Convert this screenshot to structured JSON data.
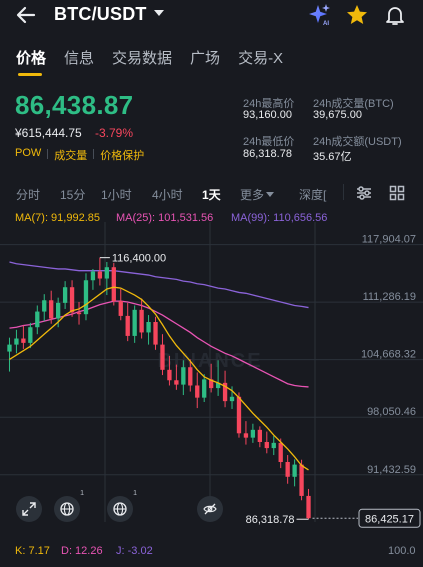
{
  "header": {
    "pair": "BTC/USDT",
    "icons": [
      "back-arrow-icon",
      "caret-down-icon",
      "ai-sparkle-icon",
      "star-icon",
      "bell-icon"
    ],
    "ai_label": "AI"
  },
  "tabs": [
    {
      "label": "价格",
      "active": true
    },
    {
      "label": "信息",
      "active": false
    },
    {
      "label": "交易数据",
      "active": false
    },
    {
      "label": "广场",
      "active": false
    },
    {
      "label": "交易-X",
      "active": false
    }
  ],
  "ticker": {
    "last_price": "86,438.87",
    "fiat_price": "¥615,444.75",
    "change_pct": "-3.79%",
    "badges": [
      "POW",
      "成交量",
      "价格保护"
    ],
    "high_label": "24h最高价",
    "high_value": "93,160.00",
    "low_label": "24h最低价",
    "low_value": "86,318.78",
    "vol_btc_label": "24h成交量(BTC)",
    "vol_btc_value": "39,675.00",
    "vol_usdt_label": "24h成交额(USDT)",
    "vol_usdt_value": "35.67亿"
  },
  "timeframes": {
    "items": [
      "分时",
      "15分",
      "1小时",
      "4小时",
      "1天",
      "更多",
      "深度["
    ],
    "active": "1天"
  },
  "ma": {
    "ma7": "MA(7): 91,992.85",
    "ma25": "MA(25): 101,531.56",
    "ma99": "MA(99): 110,656.56"
  },
  "chart_data": {
    "type": "candlestick",
    "title": "",
    "y_ticks": [
      "117,904.07",
      "111,286.19",
      "104,668.32",
      "98,050.46",
      "91,432.59"
    ],
    "ylim": [
      86000,
      120500
    ],
    "high_marker": "116,400.00",
    "low_marker": "86,318.78",
    "current_price": "86,425.17",
    "watermark": "BINANCE",
    "colors": {
      "up": "#2ebd85",
      "down": "#f6465d",
      "ma7": "#f0b90b",
      "ma25": "#e854b4",
      "ma99": "#8b63d9"
    },
    "candles": [
      {
        "o": 105600,
        "h": 107200,
        "l": 103300,
        "c": 106400
      },
      {
        "o": 106400,
        "h": 108100,
        "l": 105400,
        "c": 107100
      },
      {
        "o": 107100,
        "h": 108600,
        "l": 105900,
        "c": 106600
      },
      {
        "o": 106600,
        "h": 108900,
        "l": 106000,
        "c": 108400
      },
      {
        "o": 108400,
        "h": 110900,
        "l": 107600,
        "c": 110200
      },
      {
        "o": 110200,
        "h": 112200,
        "l": 109100,
        "c": 111500
      },
      {
        "o": 111500,
        "h": 112600,
        "l": 108800,
        "c": 109400
      },
      {
        "o": 109400,
        "h": 111800,
        "l": 108400,
        "c": 111200
      },
      {
        "o": 111200,
        "h": 113700,
        "l": 110500,
        "c": 113000
      },
      {
        "o": 113000,
        "h": 113800,
        "l": 109600,
        "c": 110100
      },
      {
        "o": 110100,
        "h": 111300,
        "l": 108700,
        "c": 109900
      },
      {
        "o": 109900,
        "h": 114600,
        "l": 109200,
        "c": 113800
      },
      {
        "o": 113800,
        "h": 115100,
        "l": 112700,
        "c": 114800
      },
      {
        "o": 114800,
        "h": 116400,
        "l": 113200,
        "c": 114000
      },
      {
        "o": 114000,
        "h": 115900,
        "l": 112100,
        "c": 115300
      },
      {
        "o": 115300,
        "h": 115800,
        "l": 110900,
        "c": 111400
      },
      {
        "o": 111400,
        "h": 112800,
        "l": 109200,
        "c": 109700
      },
      {
        "o": 109700,
        "h": 111200,
        "l": 106800,
        "c": 107400
      },
      {
        "o": 107400,
        "h": 110900,
        "l": 106600,
        "c": 110400
      },
      {
        "o": 110400,
        "h": 111700,
        "l": 107100,
        "c": 107800
      },
      {
        "o": 107800,
        "h": 109800,
        "l": 106400,
        "c": 109000
      },
      {
        "o": 109000,
        "h": 109600,
        "l": 105800,
        "c": 106400
      },
      {
        "o": 106400,
        "h": 107600,
        "l": 102900,
        "c": 103500
      },
      {
        "o": 103500,
        "h": 105100,
        "l": 101700,
        "c": 102300
      },
      {
        "o": 102300,
        "h": 104100,
        "l": 101200,
        "c": 101800
      },
      {
        "o": 101800,
        "h": 104600,
        "l": 100600,
        "c": 103800
      },
      {
        "o": 103800,
        "h": 104700,
        "l": 101000,
        "c": 101700
      },
      {
        "o": 101700,
        "h": 103200,
        "l": 99100,
        "c": 100300
      },
      {
        "o": 100300,
        "h": 103000,
        "l": 99800,
        "c": 102400
      },
      {
        "o": 102400,
        "h": 104200,
        "l": 100900,
        "c": 101400
      },
      {
        "o": 101400,
        "h": 104600,
        "l": 100500,
        "c": 102000
      },
      {
        "o": 102000,
        "h": 103400,
        "l": 99200,
        "c": 99900
      },
      {
        "o": 99900,
        "h": 101600,
        "l": 99000,
        "c": 100400
      },
      {
        "o": 100400,
        "h": 100900,
        "l": 95700,
        "c": 96200
      },
      {
        "o": 96200,
        "h": 97600,
        "l": 94900,
        "c": 95700
      },
      {
        "o": 95700,
        "h": 97300,
        "l": 95100,
        "c": 96600
      },
      {
        "o": 96600,
        "h": 97000,
        "l": 94600,
        "c": 95200
      },
      {
        "o": 95200,
        "h": 96400,
        "l": 93900,
        "c": 94500
      },
      {
        "o": 94500,
        "h": 95900,
        "l": 93700,
        "c": 95100
      },
      {
        "o": 95100,
        "h": 95600,
        "l": 92200,
        "c": 92900
      },
      {
        "o": 92900,
        "h": 93700,
        "l": 90400,
        "c": 91200
      },
      {
        "o": 91200,
        "h": 93200,
        "l": 90100,
        "c": 92600
      },
      {
        "o": 92600,
        "h": 93160,
        "l": 88500,
        "c": 89000
      },
      {
        "o": 89000,
        "h": 89800,
        "l": 86318.78,
        "c": 86438.87
      }
    ],
    "ma7": [
      104700,
      105200,
      105700,
      106200,
      106900,
      107600,
      108300,
      109000,
      109800,
      110300,
      110500,
      111000,
      111600,
      112200,
      112800,
      113000,
      112900,
      112500,
      112100,
      111600,
      110800,
      109900,
      108700,
      107400,
      106300,
      105400,
      104500,
      103500,
      102700,
      102300,
      102000,
      101600,
      101100,
      100300,
      99400,
      98500,
      97700,
      96900,
      96000,
      95200,
      94400,
      93500,
      92500,
      91990
    ],
    "ma25": [
      108300,
      108400,
      108600,
      108700,
      108900,
      109100,
      109300,
      109500,
      109700,
      109900,
      110200,
      110400,
      110700,
      111000,
      111200,
      111400,
      111400,
      111300,
      111100,
      110900,
      110600,
      110200,
      109800,
      109300,
      108800,
      108300,
      107800,
      107200,
      106700,
      106200,
      105800,
      105400,
      105100,
      104700,
      104300,
      103900,
      103500,
      103100,
      102700,
      102300,
      101900,
      101700,
      101600,
      101530
    ],
    "ma99": [
      115900,
      115700,
      115600,
      115500,
      115400,
      115300,
      115200,
      115100,
      115100,
      115000,
      114900,
      114900,
      114900,
      114900,
      114900,
      114900,
      114800,
      114700,
      114600,
      114500,
      114400,
      114200,
      114100,
      114000,
      113900,
      113700,
      113600,
      113400,
      113300,
      113100,
      112900,
      112800,
      112600,
      112400,
      112300,
      112100,
      111900,
      111700,
      111500,
      111300,
      111100,
      110900,
      110800,
      110660
    ]
  },
  "tools": [
    "expand-icon",
    "globe-icon",
    "globe-icon",
    "eye-off-icon"
  ],
  "kdj": {
    "k": "K: 7.17",
    "d": "D: 12.26",
    "j": "J: -3.02",
    "scale": "100.0"
  }
}
